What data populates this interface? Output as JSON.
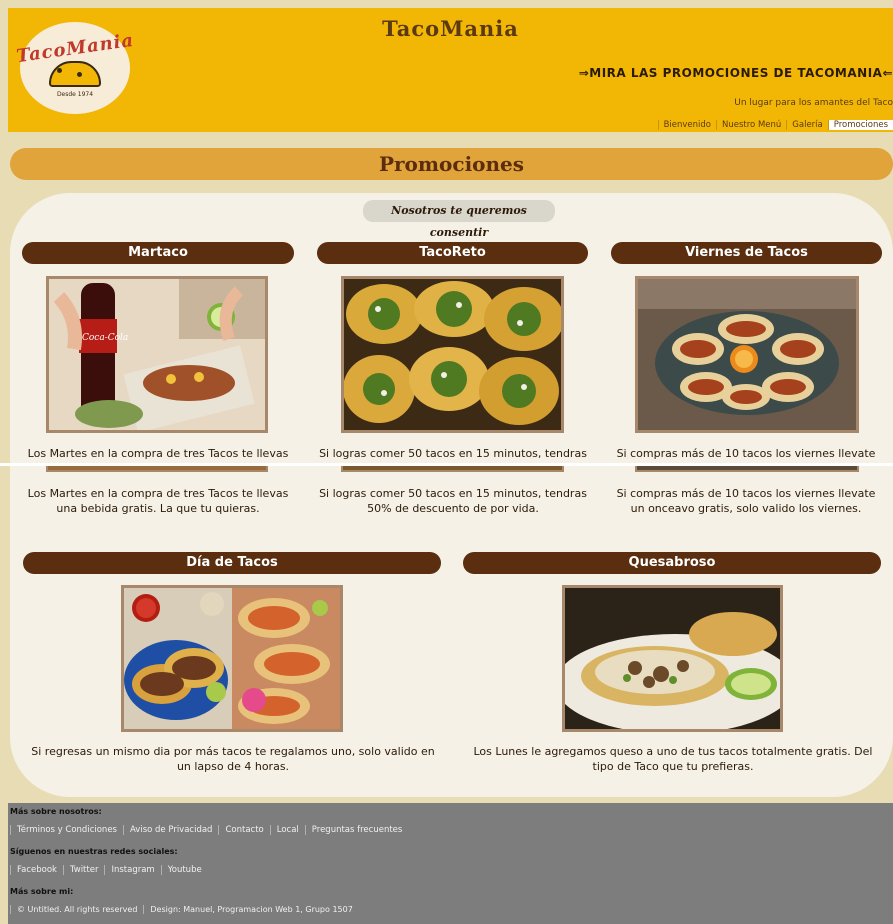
{
  "header": {
    "site_title": "TacoMania",
    "logo_text": "TacoMania",
    "logo_tag": "Desde 1974",
    "promo_text": "⇒MIRA LAS PROMOCIONES DE TACOMANIA⇐",
    "tagline": "Un lugar para los amantes del Taco",
    "nav": [
      {
        "label": "Bienvenido"
      },
      {
        "label": "Nuestro Menú"
      },
      {
        "label": "Galería"
      },
      {
        "label": "Promociones"
      }
    ]
  },
  "main": {
    "section_title": "Promociones",
    "subtitle": "Nosotros te queremos consentir",
    "cards": [
      {
        "title": "Martaco",
        "desc": "Los Martes en la compra de tres Tacos te llevas una bebida gratis. La que tu quieras."
      },
      {
        "title": "TacoReto",
        "desc": "Si logras comer 50 tacos en 15 minutos, tendras 50% de descuento de por vida."
      },
      {
        "title": "Viernes de Tacos",
        "desc": "Si compras más de 10 tacos los viernes llevate un onceavo gratis, solo valido los viernes."
      },
      {
        "title": "Día de Tacos",
        "desc": "Si regresas un mismo dia por más tacos te regalamos uno, solo valido en un lapso de 4 horas."
      },
      {
        "title": "Quesabroso",
        "desc": "Los Lunes le agregamos queso a uno de tus tacos totalmente gratis. Del tipo de Taco que tu prefieras."
      }
    ],
    "ghost_lines": [
      "Los Martes en la compra de tres Tacos te llevas",
      "Si logras comer 50 tacos en 15 minutos, tendras",
      "Si compras más de 10 tacos los viernes llevate"
    ]
  },
  "footer": {
    "about_title": "Más sobre nosotros:",
    "about_links": [
      {
        "label": "Términos y Condiciones"
      },
      {
        "label": "Aviso de Privacidad"
      },
      {
        "label": "Contacto"
      },
      {
        "label": "Local"
      },
      {
        "label": "Preguntas frecuentes"
      }
    ],
    "social_title": "Síguenos en nuestras redes sociales:",
    "social_links": [
      {
        "label": "Facebook"
      },
      {
        "label": "Twitter"
      },
      {
        "label": "Instagram"
      },
      {
        "label": "Youtube"
      }
    ],
    "me_title": "Más sobre mi:",
    "credits": [
      {
        "label": "© Untitled. All rights reserved"
      },
      {
        "label": "Design: Manuel, Programacion Web 1, Grupo 1507"
      }
    ]
  }
}
